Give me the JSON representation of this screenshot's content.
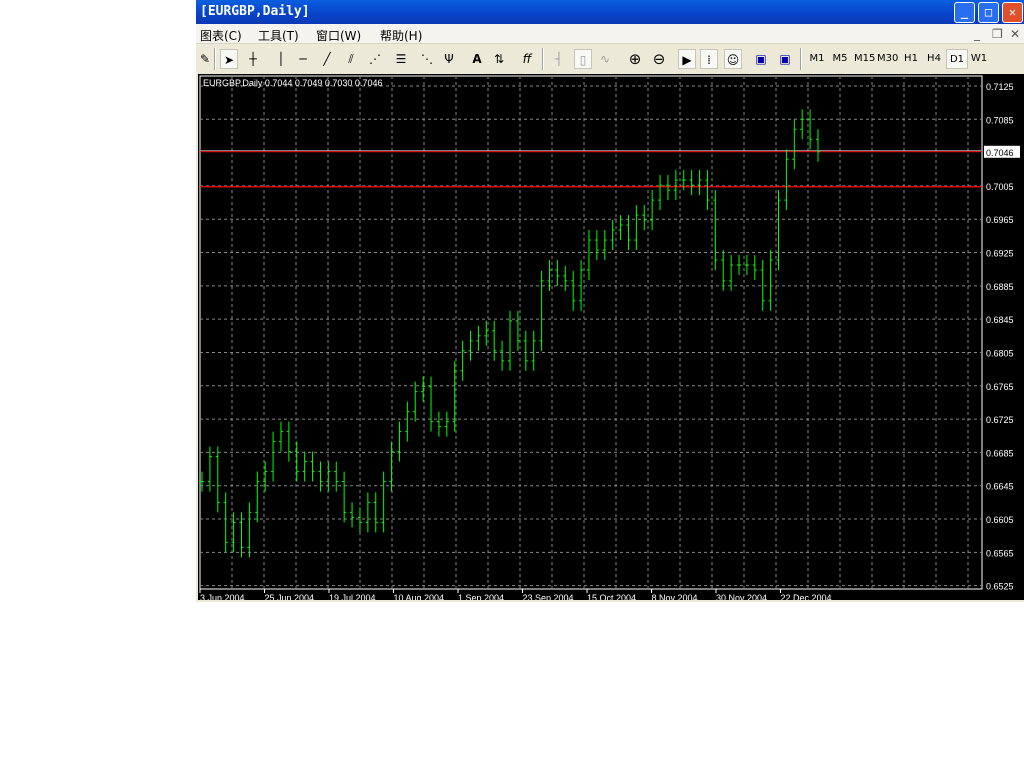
{
  "window": {
    "title": "[EURGBP,Daily]"
  },
  "menu": [
    "图表(C)",
    "工具(T)",
    "窗口(W)",
    "帮助(H)"
  ],
  "toolbar": {
    "text_tool": "A",
    "fibo": "ff",
    "timeframes": [
      "M1",
      "M5",
      "M15",
      "M30",
      "H1",
      "H4",
      "D1",
      "W1"
    ],
    "active_timeframe": "D1"
  },
  "chart_data": {
    "type": "bar",
    "title": "EURGBP,Daily  0.7044 0.7049 0.7030 0.7046",
    "symbol": "EURGBP",
    "period": "Daily",
    "ohlc_last": [
      0.7044,
      0.7049,
      0.703,
      0.7046
    ],
    "x_ticks": [
      "3 Jun 2004",
      "25 Jun 2004",
      "19 Jul 2004",
      "10 Aug 2004",
      "1 Sep 2004",
      "23 Sep 2004",
      "15 Oct 2004",
      "8 Nov 2004",
      "30 Nov 2004",
      "22 Dec 2004"
    ],
    "y_ticks": [
      "0.7125",
      "0.7085",
      "0.7005",
      "0.6965",
      "0.6925",
      "0.6885",
      "0.6845",
      "0.6805",
      "0.6765",
      "0.6725",
      "0.6685",
      "0.6645",
      "0.6605",
      "0.6565",
      "0.6525"
    ],
    "ylim": [
      0.6521,
      0.7137
    ],
    "current_price": "0.7046",
    "horizontal_line": 0.7004,
    "grid": true,
    "background": "#000000",
    "bar_color": "#00ff00",
    "line_color": "#ff0000",
    "closes": [
      0.665,
      0.668,
      0.6625,
      0.6577,
      0.6601,
      0.6571,
      0.6613,
      0.665,
      0.6662,
      0.6698,
      0.671,
      0.6686,
      0.6662,
      0.6674,
      0.6662,
      0.665,
      0.6662,
      0.665,
      0.6613,
      0.6607,
      0.6601,
      0.6625,
      0.6601,
      0.665,
      0.6686,
      0.671,
      0.6734,
      0.6758,
      0.6764,
      0.6722,
      0.6716,
      0.6722,
      0.6783,
      0.6807,
      0.6819,
      0.6825,
      0.6831,
      0.6807,
      0.6795,
      0.6843,
      0.6819,
      0.6795,
      0.6819,
      0.6891,
      0.6904,
      0.6897,
      0.6891,
      0.6867,
      0.6904,
      0.694,
      0.6928,
      0.694,
      0.6952,
      0.6958,
      0.694,
      0.697,
      0.6964,
      0.6988,
      0.7006,
      0.7,
      0.7012,
      0.7012,
      0.7006,
      0.7012,
      0.6988,
      0.6916,
      0.6891,
      0.691,
      0.691,
      0.691,
      0.6904,
      0.6867,
      0.6916,
      0.6988,
      0.7037,
      0.7073,
      0.7085,
      0.7061,
      0.7046
    ]
  }
}
